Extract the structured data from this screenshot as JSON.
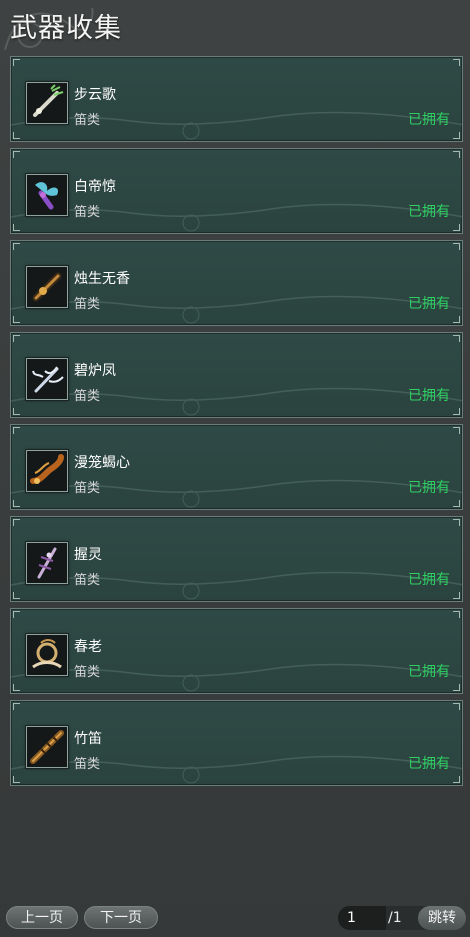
{
  "page_title": "武器收集",
  "items": [
    {
      "name": "步云歌",
      "type": "笛类",
      "status": "已拥有",
      "icon": "flute-jade-icon"
    },
    {
      "name": "白帝惊",
      "type": "笛类",
      "status": "已拥有",
      "icon": "flute-butterfly-icon"
    },
    {
      "name": "烛生无香",
      "type": "笛类",
      "status": "已拥有",
      "icon": "flute-bronze-icon"
    },
    {
      "name": "碧炉凤",
      "type": "笛类",
      "status": "已拥有",
      "icon": "flute-phoenix-icon"
    },
    {
      "name": "漫笼蝎心",
      "type": "笛类",
      "status": "已拥有",
      "icon": "flute-scorpion-icon"
    },
    {
      "name": "握灵",
      "type": "笛类",
      "status": "已拥有",
      "icon": "flute-spirit-icon"
    },
    {
      "name": "春老",
      "type": "笛类",
      "status": "已拥有",
      "icon": "flute-ornate-icon"
    },
    {
      "name": "竹笛",
      "type": "笛类",
      "status": "已拥有",
      "icon": "flute-bamboo-icon"
    }
  ],
  "footer": {
    "prev_label": "上一页",
    "next_label": "下一页",
    "page_current": "1",
    "page_total": "/1",
    "jump_label": "跳转"
  },
  "colors": {
    "owned": "#2fd063",
    "card_bg": "#2d4743"
  }
}
